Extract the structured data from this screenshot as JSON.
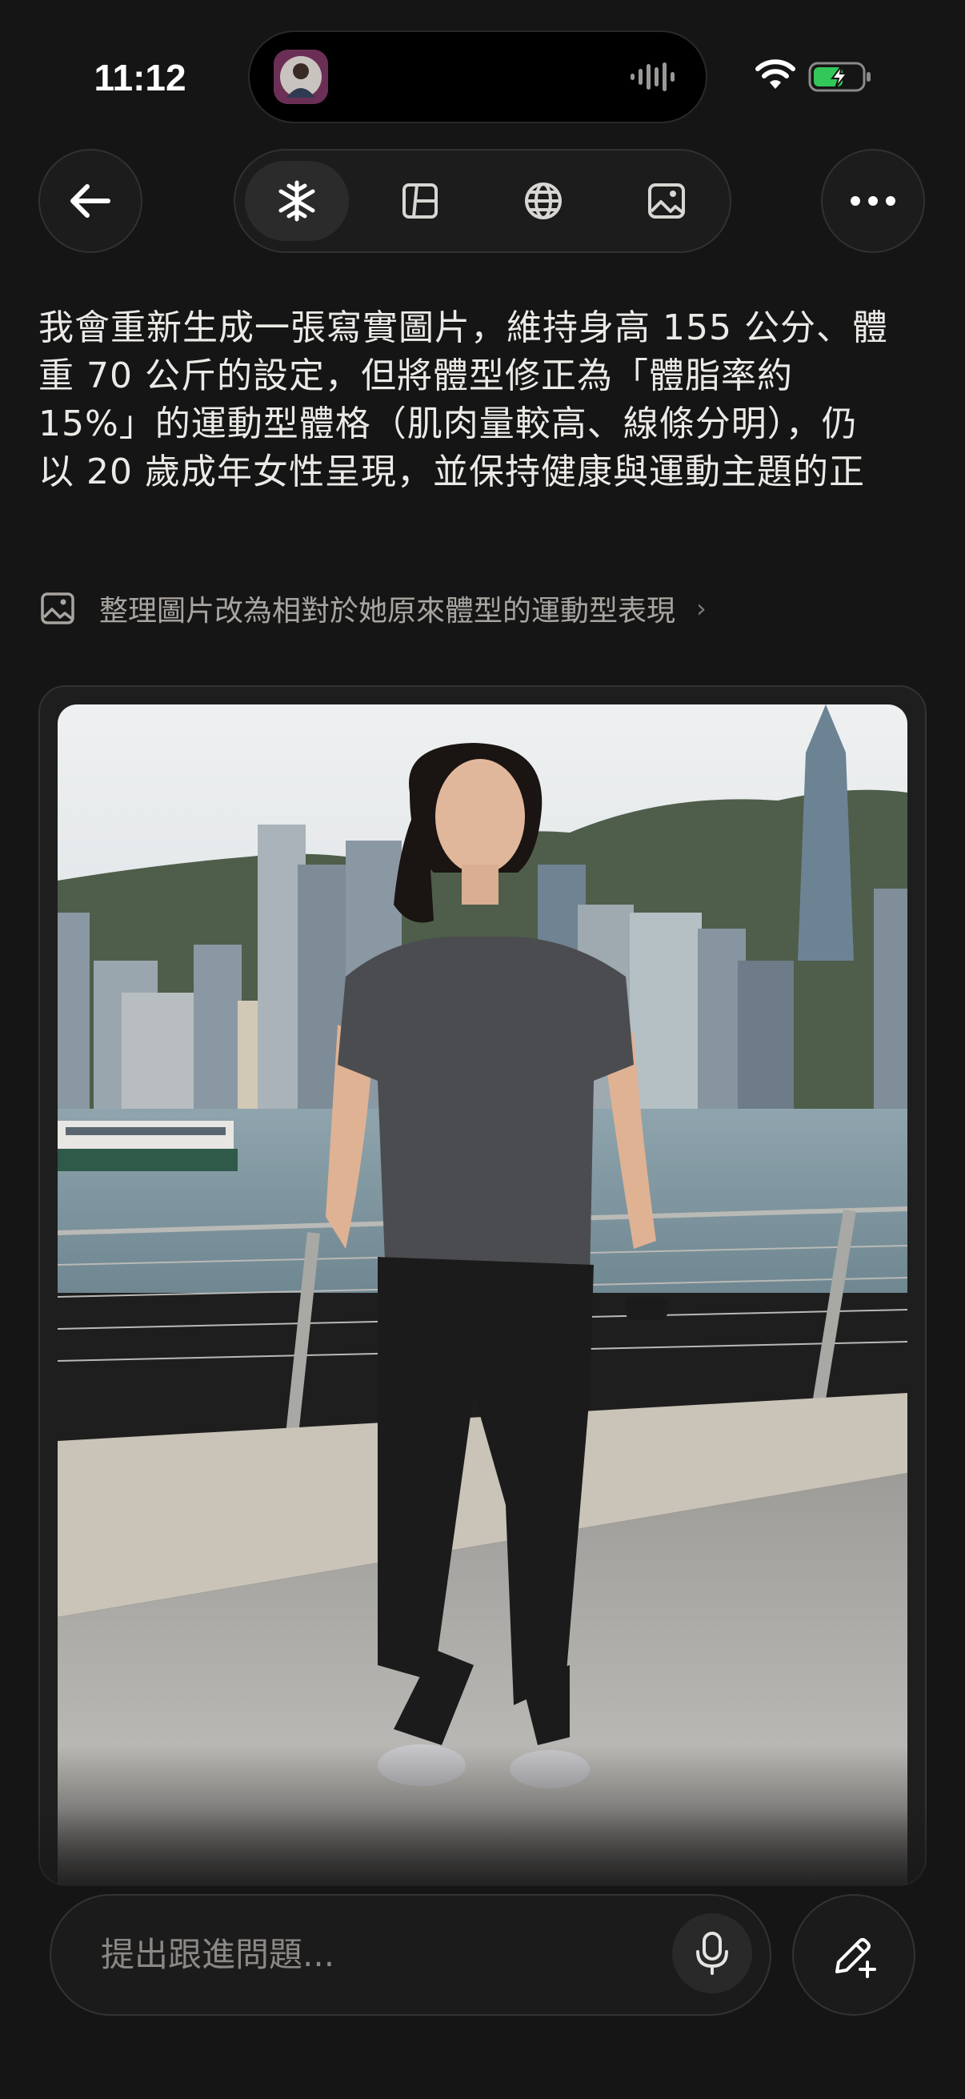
{
  "status_bar": {
    "time": "11:12"
  },
  "icons": {
    "back": "arrow-left-icon",
    "more": "more-horizontal-icon",
    "tools": [
      "sparkle-icon",
      "canvas-icon",
      "globe-icon",
      "image-icon"
    ],
    "attachment": "image-icon",
    "mic": "microphone-icon",
    "compose": "pen-plus-icon"
  },
  "message": {
    "lines": [
      "我會重新生成一張寫實圖片，維持身高 155 公分、體",
      "重 70 公斤的設定，但將體型修正為「體脂率約",
      "15%」的運動型體格（肌肉量較高、線條分明），仍",
      "以 20 歲成年女性呈現，並保持健康與運動主題的正"
    ]
  },
  "attachment": {
    "label": "整理圖片改為相對於她原來體型的運動型表現",
    "chevron": "›"
  },
  "composer": {
    "placeholder": "提出跟進問題..."
  },
  "colors": {
    "background": "#161515",
    "surface": "#1d1c1c",
    "battery_green": "#33c759"
  }
}
